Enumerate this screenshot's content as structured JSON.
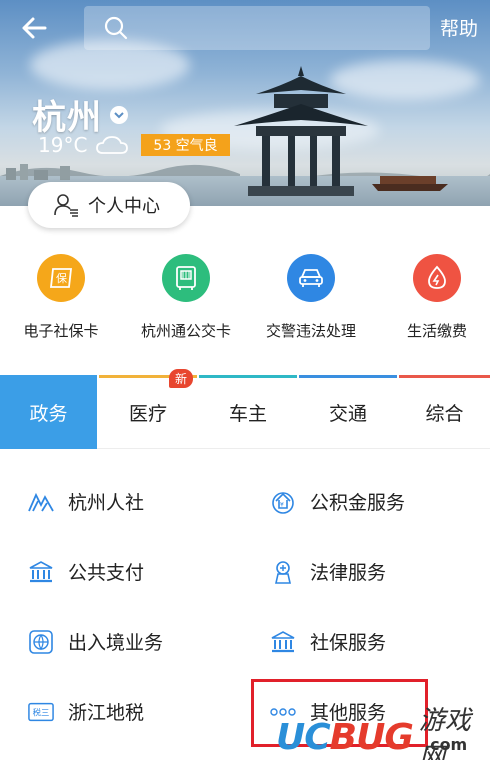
{
  "header": {
    "help_label": "帮助",
    "search_placeholder": ""
  },
  "location": {
    "city": "杭州",
    "temperature": "19°C",
    "aqi_label": "53 空气良"
  },
  "personal_center": {
    "label": "个人中心"
  },
  "quick_services": [
    {
      "label": "电子社保卡",
      "icon": "social-security-icon",
      "color": "#f5a71a"
    },
    {
      "label": "杭州通公交卡",
      "icon": "bus-card-icon",
      "color": "#2dbd7d"
    },
    {
      "label": "交警违法处理",
      "icon": "car-icon",
      "color": "#2f87e3"
    },
    {
      "label": "生活缴费",
      "icon": "utility-payment-icon",
      "color": "#ef5342"
    }
  ],
  "tabs": [
    {
      "label": "政务",
      "active": true
    },
    {
      "label": "医疗",
      "badge": "新",
      "line_color": "#f1b23a"
    },
    {
      "label": "车主",
      "line_color": "#2fb8c6"
    },
    {
      "label": "交通",
      "line_color": "#3a8fe0"
    },
    {
      "label": "综合",
      "line_color": "#e9584a"
    }
  ],
  "services": [
    {
      "label": "杭州人社",
      "icon": "mountain-logo-icon"
    },
    {
      "label": "公积金服务",
      "icon": "housing-fund-icon"
    },
    {
      "label": "公共支付",
      "icon": "bank-building-icon"
    },
    {
      "label": "法律服务",
      "icon": "law-icon"
    },
    {
      "label": "出入境业务",
      "icon": "globe-icon"
    },
    {
      "label": "社保服务",
      "icon": "bank-building-icon"
    },
    {
      "label": "浙江地税",
      "icon": "tax-icon"
    },
    {
      "label": "其他服务",
      "icon": "more-dots-icon"
    }
  ],
  "watermark": {
    "brand_a": "UC",
    "brand_b": "BUG",
    "site": "游戏网",
    "domain": ".com"
  },
  "colors": {
    "accent": "#3b9ee7",
    "icon_blue": "#2f87e3",
    "highlight_red": "#e1202a"
  }
}
